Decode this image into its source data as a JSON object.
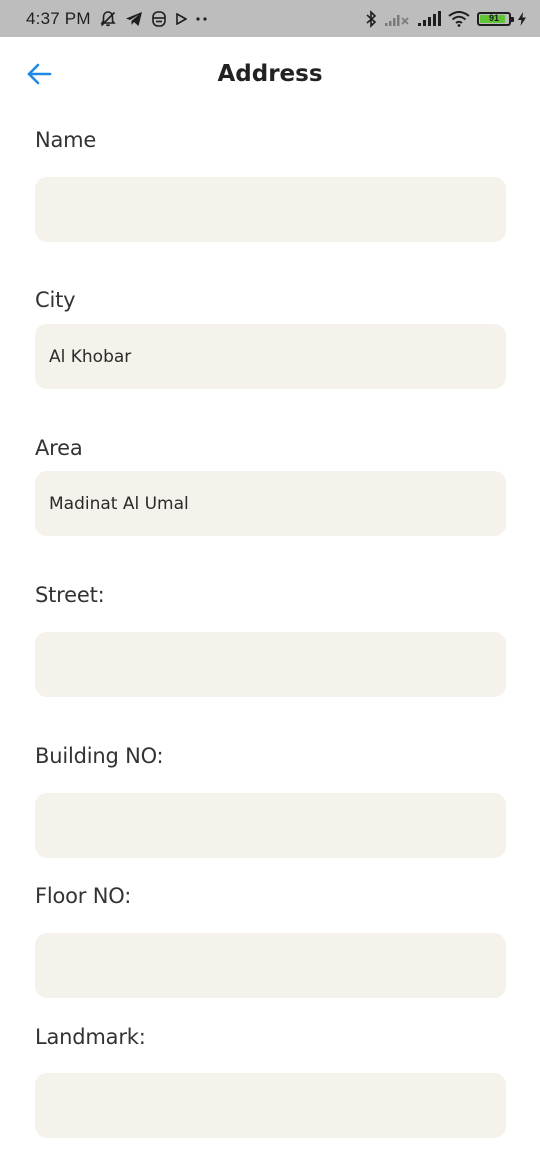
{
  "status_bar": {
    "time": "4:37 PM",
    "battery_level": 91,
    "battery_text": "91",
    "battery_color": "#5fc537"
  },
  "header": {
    "title": "Address",
    "back_icon": "arrow-left-icon",
    "accent": "#1e88e5"
  },
  "form": {
    "field_background": "#f5f1eb",
    "fields": [
      {
        "label": "Name",
        "value": ""
      },
      {
        "label": "City",
        "value": "Al Khobar"
      },
      {
        "label": "Area",
        "value": "Madinat Al Umal"
      },
      {
        "label": "Street:",
        "value": ""
      },
      {
        "label": "Building NO:",
        "value": ""
      },
      {
        "label": "Floor NO:",
        "value": ""
      },
      {
        "label": "Landmark:",
        "value": ""
      }
    ]
  }
}
